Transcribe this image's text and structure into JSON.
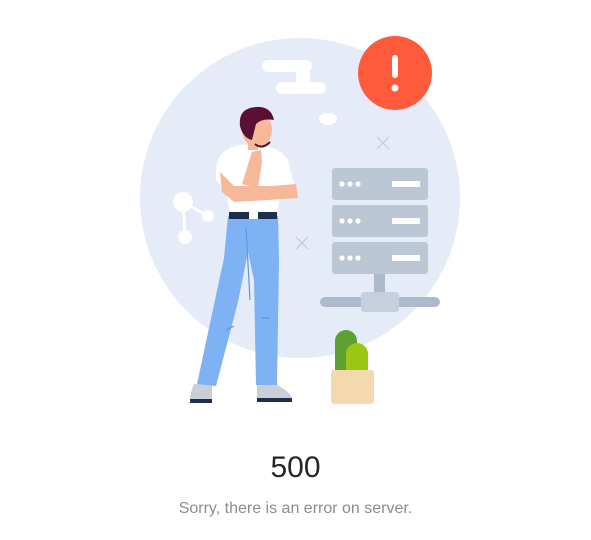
{
  "result": {
    "status_code": "500",
    "message": "Sorry, there is an error on server."
  },
  "illustration": {
    "icon": "server-error-illustration",
    "alert_symbol": "!",
    "colors": {
      "background_circle": "#e6ebf8",
      "alert": "#ff5a3c",
      "server": "#bcc7d6",
      "jeans": "#7fb2f5",
      "skin": "#f7b89a",
      "hair": "#5a1032",
      "plant_dark": "#5ea130",
      "plant_light": "#9bc613",
      "pot": "#f5d9ae"
    }
  }
}
